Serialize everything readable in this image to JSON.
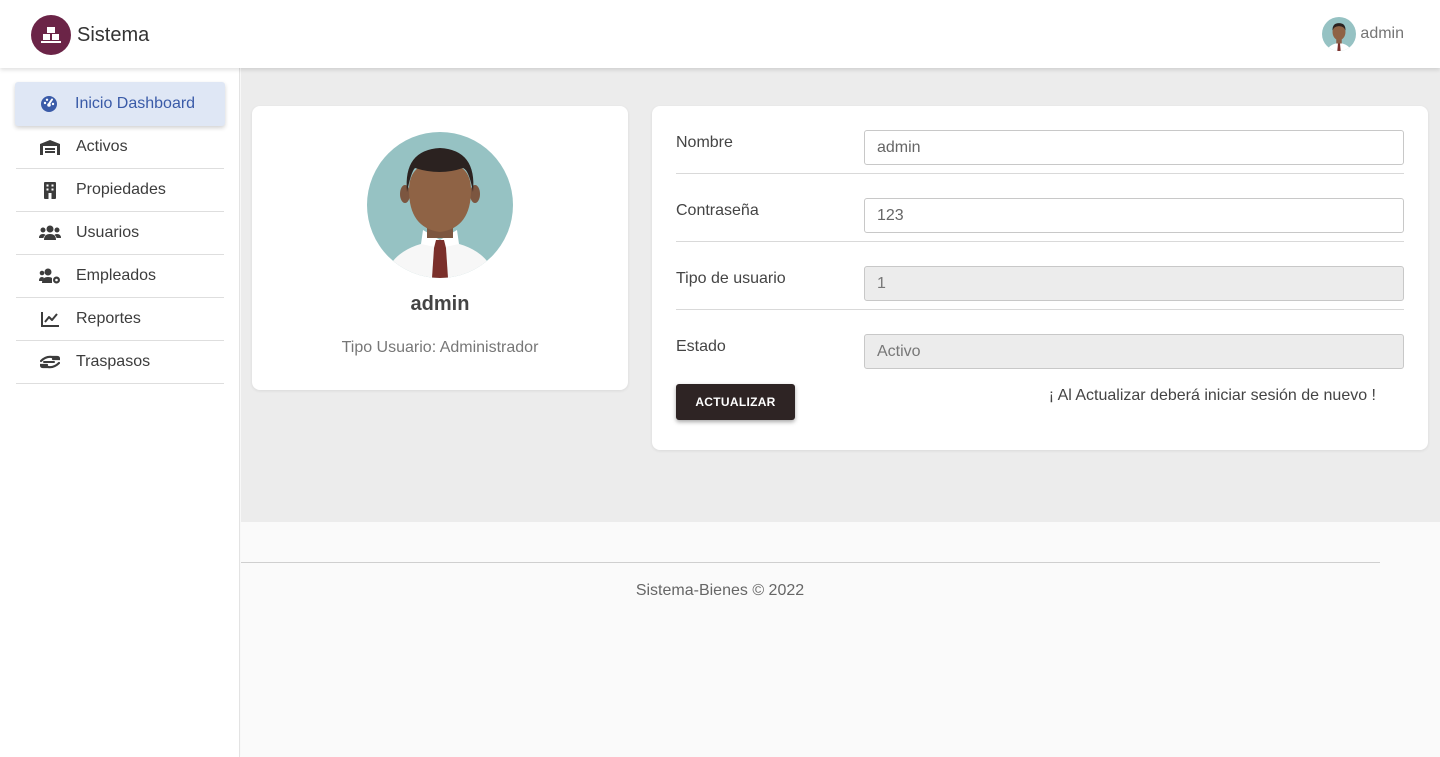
{
  "app": {
    "title": "Sistema",
    "logo_icon": "building-logo-icon",
    "brand_color": "#6b2447"
  },
  "user_menu": {
    "name": "admin",
    "avatar_icon": "user-avatar-icon"
  },
  "sidebar": {
    "items": [
      {
        "label": "Inicio Dashboard",
        "icon": "dashboard-icon",
        "active": true
      },
      {
        "label": "Activos",
        "icon": "warehouse-icon"
      },
      {
        "label": "Propiedades",
        "icon": "building-icon"
      },
      {
        "label": "Usuarios",
        "icon": "users-icon"
      },
      {
        "label": "Empleados",
        "icon": "users-gear-icon"
      },
      {
        "label": "Reportes",
        "icon": "chart-line-icon"
      },
      {
        "label": "Traspasos",
        "icon": "hand-transfer-icon"
      }
    ]
  },
  "profile": {
    "name": "admin",
    "type": "Tipo Usuario: Administrador"
  },
  "form": {
    "fields": [
      {
        "label": "Nombre",
        "value": "admin",
        "disabled": false
      },
      {
        "label": "Contraseña",
        "value": "123",
        "disabled": false
      },
      {
        "label": "Tipo de usuario",
        "value": "1",
        "disabled": true
      },
      {
        "label": "Estado",
        "value": "Activo",
        "disabled": true
      }
    ],
    "submit_label": "ACTUALIZAR",
    "note": "¡ Al Actualizar deberá iniciar sesión de nuevo !"
  },
  "footer": {
    "text": "Sistema-Bienes © 2022"
  }
}
